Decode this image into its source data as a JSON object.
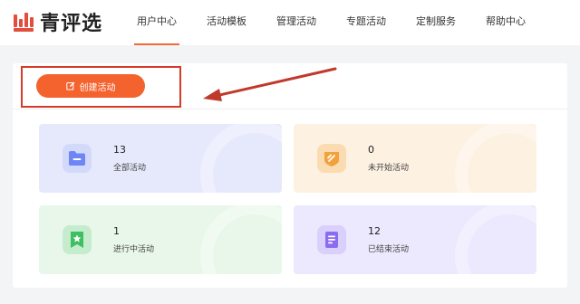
{
  "brand": {
    "name": "青评选",
    "color": "#e24d3d"
  },
  "nav": {
    "items": [
      {
        "label": "用户中心",
        "active": true
      },
      {
        "label": "活动模板",
        "active": false
      },
      {
        "label": "管理活动",
        "active": false
      },
      {
        "label": "专题活动",
        "active": false
      },
      {
        "label": "定制服务",
        "active": false
      },
      {
        "label": "帮助中心",
        "active": false
      }
    ],
    "accent": "#f06a3a"
  },
  "toolbar": {
    "create_label": "创建活动",
    "create_icon": "edit-icon",
    "button_color": "#f4622d"
  },
  "annotation": {
    "color": "#d63a2a"
  },
  "stats": [
    {
      "count": "13",
      "label": "全部活动",
      "icon": "folder-icon",
      "color": "#6e86f5"
    },
    {
      "count": "0",
      "label": "未开始活动",
      "icon": "ticket-icon",
      "color": "#f3a13c"
    },
    {
      "count": "1",
      "label": "进行中活动",
      "icon": "star-bookmark-icon",
      "color": "#3dbf62"
    },
    {
      "count": "12",
      "label": "已结束活动",
      "icon": "document-icon",
      "color": "#8b6cf0"
    }
  ]
}
